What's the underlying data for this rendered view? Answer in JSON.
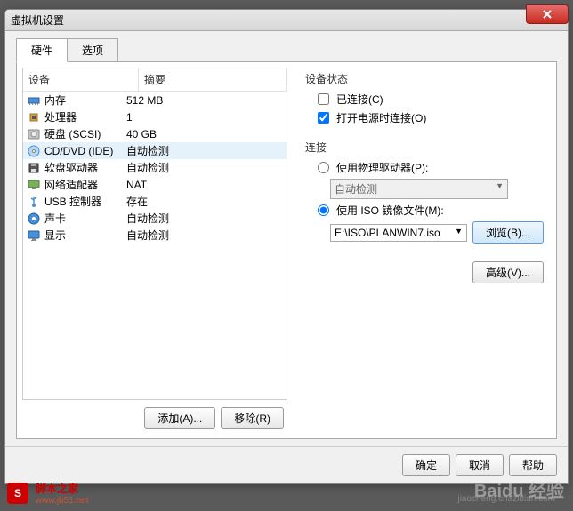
{
  "window": {
    "title": "虚拟机设置"
  },
  "tabs": {
    "hardware": "硬件",
    "options": "选项"
  },
  "list": {
    "header_device": "设备",
    "header_summary": "摘要",
    "rows": [
      {
        "device": "内存",
        "summary": "512 MB",
        "icon": "memory"
      },
      {
        "device": "处理器",
        "summary": "1",
        "icon": "cpu"
      },
      {
        "device": "硬盘 (SCSI)",
        "summary": "40 GB",
        "icon": "disk"
      },
      {
        "device": "CD/DVD (IDE)",
        "summary": "自动检测",
        "icon": "cd"
      },
      {
        "device": "软盘驱动器",
        "summary": "自动检测",
        "icon": "floppy"
      },
      {
        "device": "网络适配器",
        "summary": "NAT",
        "icon": "network"
      },
      {
        "device": "USB 控制器",
        "summary": "存在",
        "icon": "usb"
      },
      {
        "device": "声卡",
        "summary": "自动检测",
        "icon": "sound"
      },
      {
        "device": "显示",
        "summary": "自动检测",
        "icon": "display"
      }
    ]
  },
  "buttons": {
    "add": "添加(A)...",
    "remove": "移除(R)",
    "ok": "确定",
    "cancel": "取消",
    "help": "帮助",
    "browse": "浏览(B)...",
    "advanced": "高级(V)..."
  },
  "right": {
    "status_title": "设备状态",
    "connected": "已连接(C)",
    "connect_poweron": "打开电源时连接(O)",
    "connection_title": "连接",
    "use_physical": "使用物理驱动器(P):",
    "physical_value": "自动检测",
    "use_iso": "使用 ISO 镜像文件(M):",
    "iso_path": "E:\\ISO\\PLANWIN7.iso"
  },
  "watermarks": {
    "site_name": "脚本之家",
    "site_url": "www.jb51.net",
    "baidu": "Baidu 经验",
    "chazidian": "jiaocheng.chazidian.com"
  }
}
